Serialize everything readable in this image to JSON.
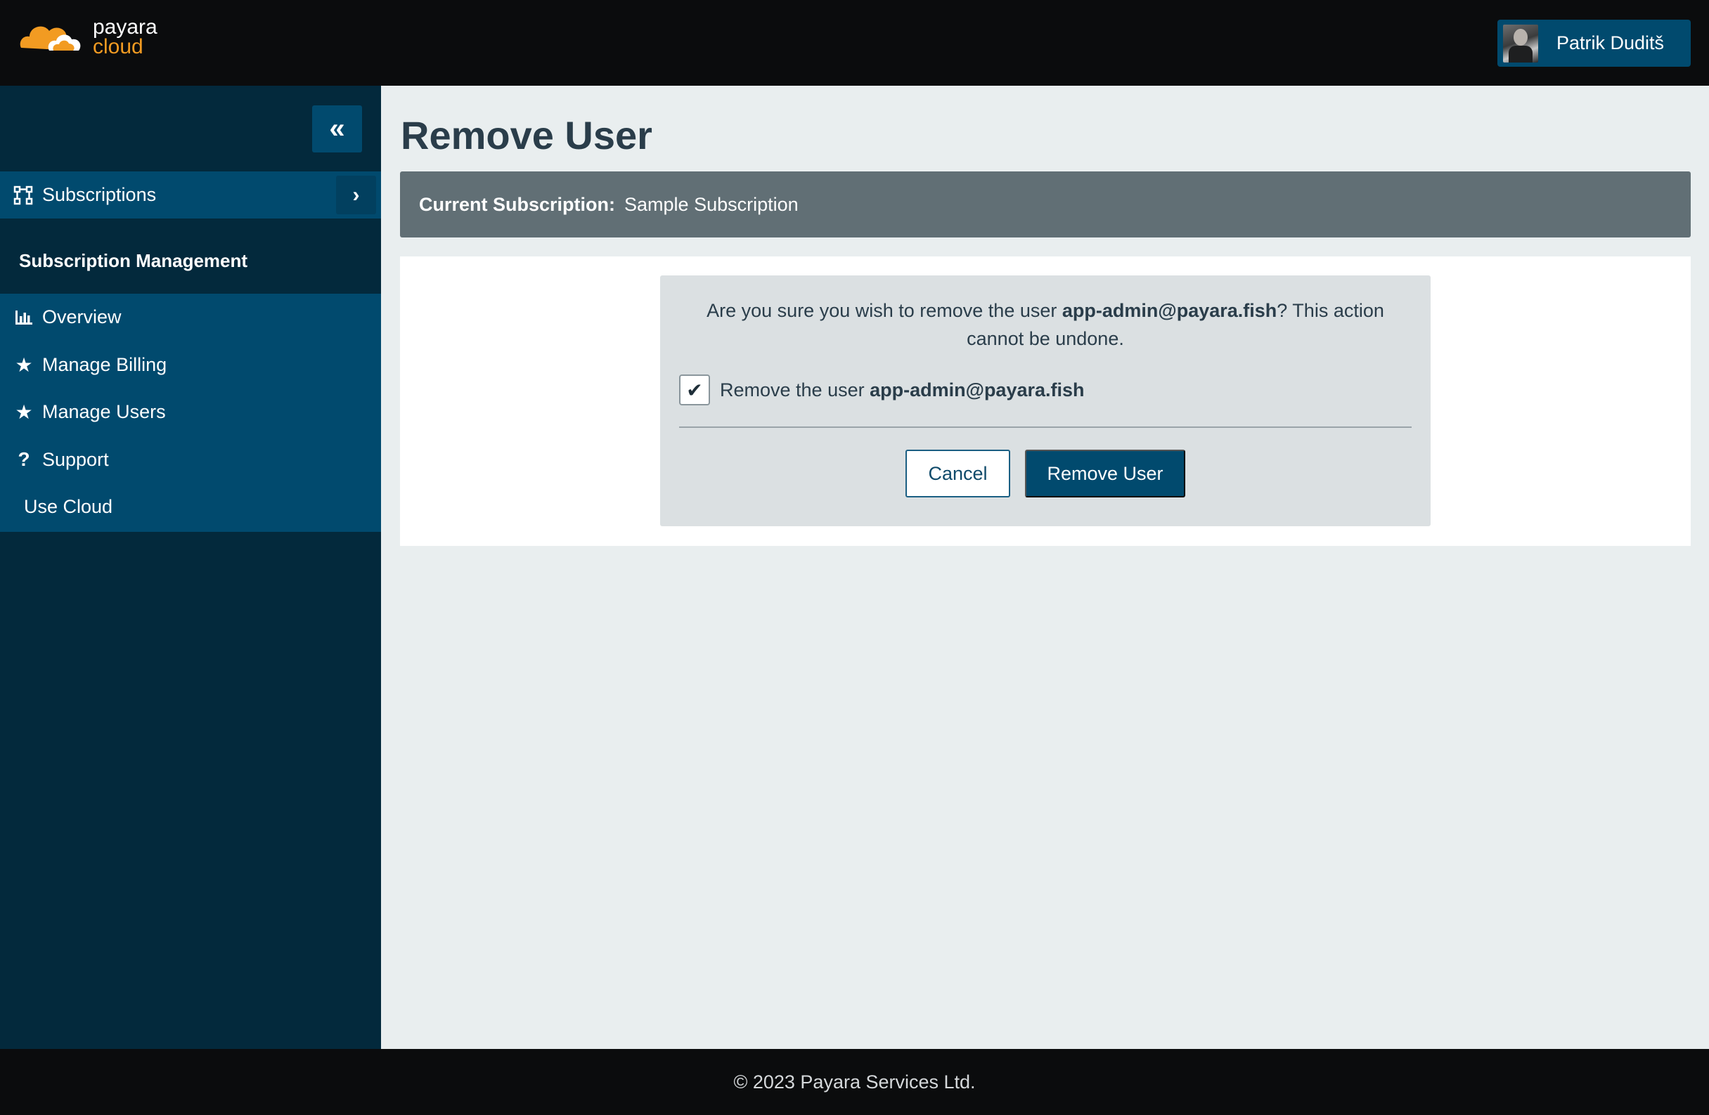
{
  "brand": {
    "line1": "payara",
    "line2": "cloud",
    "accent": "#f29b22"
  },
  "user": {
    "name": "Patrik Duditš"
  },
  "sidebar": {
    "collapse_icon": "double-chevron-left-icon",
    "subscriptions_label": "Subscriptions",
    "section_title": "Subscription Management",
    "items": [
      {
        "label": "Overview",
        "icon": "bar-chart-icon"
      },
      {
        "label": "Manage Billing",
        "icon": "star-icon"
      },
      {
        "label": "Manage Users",
        "icon": "star-icon"
      },
      {
        "label": "Support",
        "icon": "question-icon"
      },
      {
        "label": "Use Cloud",
        "icon": ""
      }
    ]
  },
  "main": {
    "title": "Remove User",
    "current_subscription": {
      "key": "Current Subscription:",
      "value": "Sample Subscription"
    },
    "confirm": {
      "question_prefix": "Are you sure you wish to remove the user ",
      "email": "app-admin@payara.fish",
      "question_suffix": "? This action cannot be undone.",
      "checkbox_prefix": "Remove the user ",
      "checkbox_email": "app-admin@payara.fish",
      "checked": true,
      "cancel_label": "Cancel",
      "remove_label": "Remove User"
    }
  },
  "footer": {
    "text": "© 2023 Payara Services Ltd."
  },
  "colors": {
    "primary": "#014a6e",
    "sidebar": "#03293c",
    "banner": "#616f75"
  }
}
